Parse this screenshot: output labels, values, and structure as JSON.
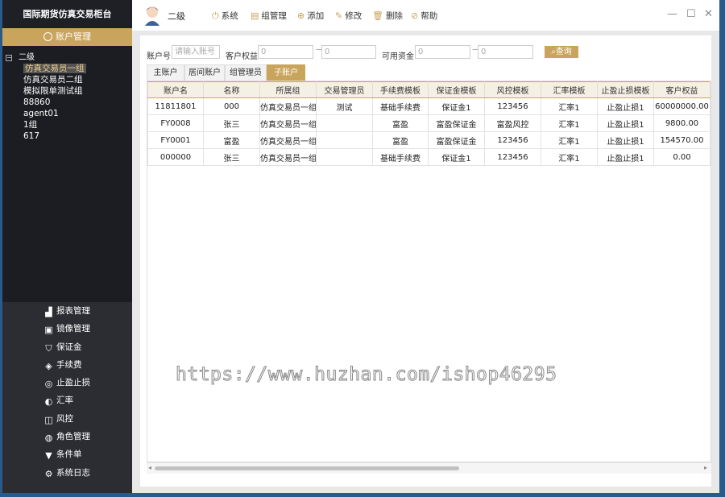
{
  "brand": "国际期货仿真交易柜台",
  "sidebar": {
    "account_mgmt": "账户管理",
    "tree_root": "二级",
    "tree_items": [
      "仿真交易员一组",
      "仿真交易员二组",
      "模拟限单测试组",
      "88860",
      "agent01",
      "1组",
      "617"
    ],
    "menu": [
      {
        "icon": "chart-icon",
        "label": "报表管理"
      },
      {
        "icon": "mirror-icon",
        "label": "镜像管理"
      },
      {
        "icon": "shield-icon",
        "label": "保证金"
      },
      {
        "icon": "fee-icon",
        "label": "手续费"
      },
      {
        "icon": "stop-icon",
        "label": "止盈止损"
      },
      {
        "icon": "exchange-icon",
        "label": "汇率"
      },
      {
        "icon": "risk-icon",
        "label": "风控"
      },
      {
        "icon": "role-icon",
        "label": "角色管理"
      },
      {
        "icon": "filter-icon",
        "label": "条件单"
      },
      {
        "icon": "log-icon",
        "label": "系统日志"
      }
    ]
  },
  "topbar": {
    "user": "二级",
    "buttons": [
      "系统",
      "组管理",
      "添加",
      "修改",
      "删除",
      "帮助"
    ]
  },
  "filters": {
    "account_label": "账户号",
    "account_placeholder": "请输入账号",
    "equity_label": "客户权益",
    "equity_from": "0",
    "equity_to": "0",
    "funds_label": "可用资金",
    "funds_from": "0",
    "funds_to": "0",
    "query": "查询"
  },
  "tabs": [
    "主账户",
    "居间账户",
    "组管理员",
    "子账户"
  ],
  "table": {
    "columns": [
      "账户名",
      "名称",
      "所属组",
      "交易管理员",
      "手续费模板",
      "保证金模板",
      "风控模板",
      "汇率模板",
      "止盈止损模板",
      "客户权益"
    ],
    "rows": [
      [
        "11811801",
        "000",
        "仿真交易员一组",
        "测试",
        "基础手续费",
        "保证金1",
        "123456",
        "汇率1",
        "止盈止损1",
        "60000000.00"
      ],
      [
        "FY0008",
        "张三",
        "仿真交易员一组",
        "",
        "富盈",
        "富盈保证金",
        "富盈风控",
        "汇率1",
        "止盈止损1",
        "9800.00"
      ],
      [
        "FY0001",
        "富盈",
        "仿真交易员一组",
        "",
        "富盈",
        "富盈保证金",
        "123456",
        "汇率1",
        "止盈止损1",
        "154570.00"
      ],
      [
        "000000",
        "张三",
        "仿真交易员一组",
        "",
        "基础手续费",
        "保证金1",
        "123456",
        "汇率1",
        "止盈止损1",
        "0.00"
      ]
    ]
  },
  "watermark": "https://www.huzhan.com/ishop46295",
  "colors": {
    "accent": "#c9a45c",
    "sidebar": "#1b1d22"
  }
}
